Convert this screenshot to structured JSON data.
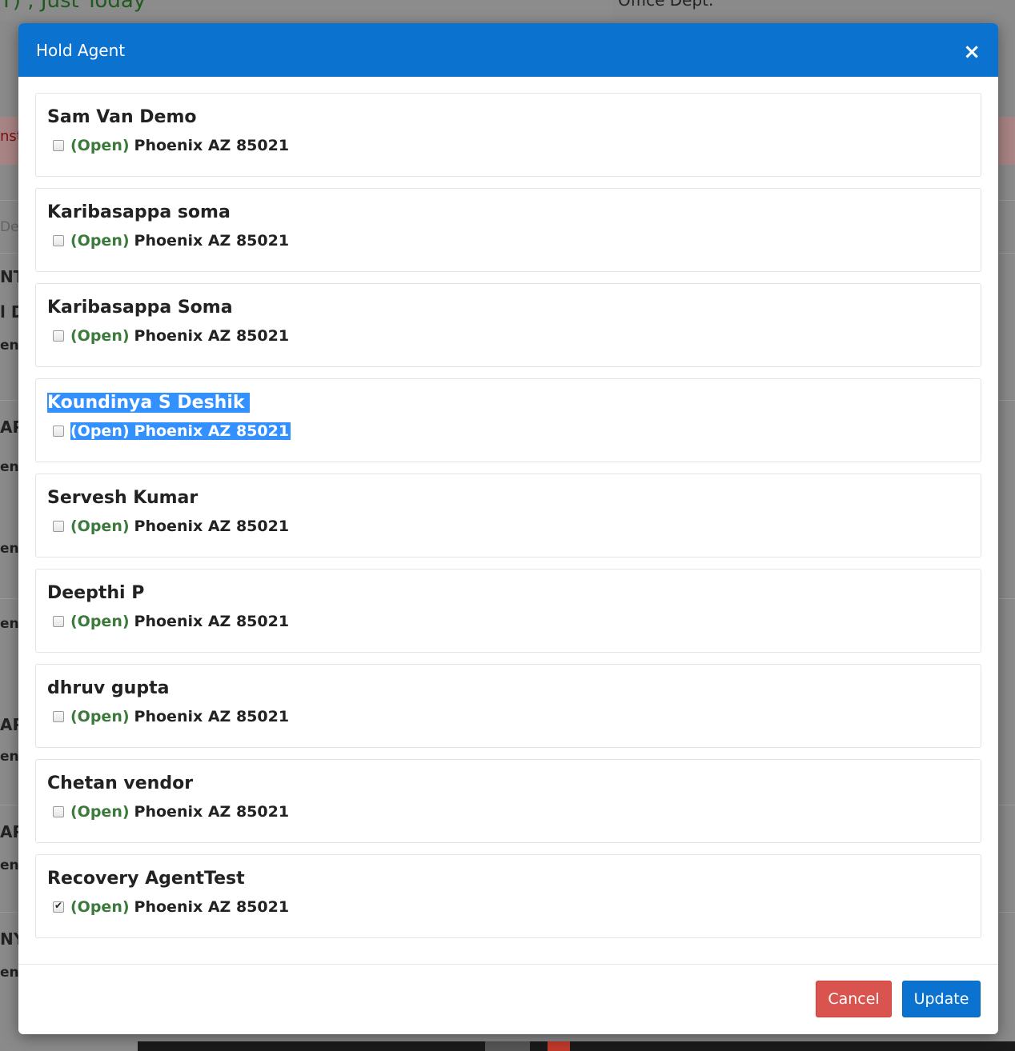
{
  "background": {
    "top_text": "T) , Just Today",
    "right_text": "Office Dept.",
    "banner_text": "nst",
    "fragments": [
      "De",
      "NT",
      "l D",
      "ent",
      "AP",
      "ent",
      "ent",
      "ent",
      "AP",
      "ent",
      "AP",
      "ent",
      "NY",
      "ent"
    ]
  },
  "modal": {
    "title": "Hold Agent",
    "close_label": "×",
    "agents": [
      {
        "name": "Sam Van Demo",
        "status": "(Open)",
        "location": "Phoenix AZ 85021",
        "checked": false
      },
      {
        "name": "Karibasappa soma",
        "status": "(Open)",
        "location": "Phoenix AZ 85021",
        "checked": false
      },
      {
        "name": "Karibasappa Soma",
        "status": "(Open)",
        "location": "Phoenix AZ 85021",
        "checked": false
      },
      {
        "name": "Koundinya S Deshik",
        "status": "(Open)",
        "location": "Phoenix AZ 85021",
        "checked": false
      },
      {
        "name": "Servesh Kumar",
        "status": "(Open)",
        "location": "Phoenix AZ 85021",
        "checked": false
      },
      {
        "name": "Deepthi P",
        "status": "(Open)",
        "location": "Phoenix AZ 85021",
        "checked": false
      },
      {
        "name": "dhruv gupta",
        "status": "(Open)",
        "location": "Phoenix AZ 85021",
        "checked": false
      },
      {
        "name": "Chetan vendor",
        "status": "(Open)",
        "location": "Phoenix AZ 85021",
        "checked": false
      },
      {
        "name": "Recovery AgentTest",
        "status": "(Open)",
        "location": "Phoenix AZ 85021",
        "checked": true
      }
    ],
    "footer": {
      "cancel_label": "Cancel",
      "update_label": "Update"
    }
  },
  "colors": {
    "header": "#0b72d0",
    "status_open": "#3c7a3c",
    "cancel": "#d9534f",
    "update": "#0b72d0",
    "selection": "#3390ff"
  }
}
